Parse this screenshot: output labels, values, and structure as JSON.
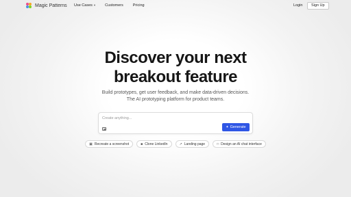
{
  "nav": {
    "brand": "Magic Patterns",
    "links": [
      {
        "label": "Use Cases",
        "has_dropdown": true
      },
      {
        "label": "Customers"
      },
      {
        "label": "Pricing"
      }
    ],
    "login": "Login",
    "signup": "Sign Up"
  },
  "hero": {
    "title_line1": "Discover your next",
    "title_line2": "breakout feature",
    "subtitle_line1": "Build prototypes, get user feedback, and make data-driven decisions.",
    "subtitle_line2": "The AI prototyping platform for product teams."
  },
  "prompt": {
    "placeholder": "Create anything...",
    "value": "",
    "generate_label": "Generate"
  },
  "chips": [
    {
      "icon": "image-icon",
      "label": "Recreate a screenshot"
    },
    {
      "icon": "linkedin-icon",
      "label": "Clone LinkedIn"
    },
    {
      "icon": "wand-icon",
      "label": "Landing page"
    },
    {
      "icon": "chat-icon",
      "label": "Design an AI chat interface"
    }
  ],
  "colors": {
    "accent": "#2f56e5",
    "background": "#f3f3f3"
  }
}
